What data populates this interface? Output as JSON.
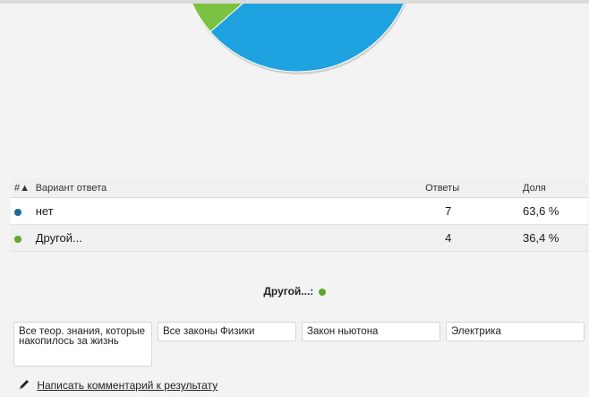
{
  "chart_data": {
    "type": "pie",
    "slices": [
      {
        "label": "нет",
        "value": 63.6,
        "color": "#1fa2e0",
        "data_label": "63,6 %"
      },
      {
        "label": "Другой...",
        "value": 36.4,
        "color": "#7cc242"
      }
    ]
  },
  "table": {
    "headers": {
      "num": "#▲",
      "option": "Вариант ответа",
      "count": "Ответы",
      "share": "Доля"
    },
    "rows": [
      {
        "label": "нет",
        "count": "7",
        "share": "63,6 %",
        "dot_color": "#1a6c98"
      },
      {
        "label": "Другой...",
        "count": "4",
        "share": "36,4 %",
        "dot_color": "#62a52e"
      }
    ]
  },
  "other": {
    "title": "Другой...:",
    "dot_color": "#62a52e",
    "responses": [
      "Все теор. знания, которые  накопилось за жизнь",
      "Все законы Физики",
      "Закон ньютона",
      "Электрика"
    ]
  },
  "comment_link": "Написать комментарий к результату"
}
